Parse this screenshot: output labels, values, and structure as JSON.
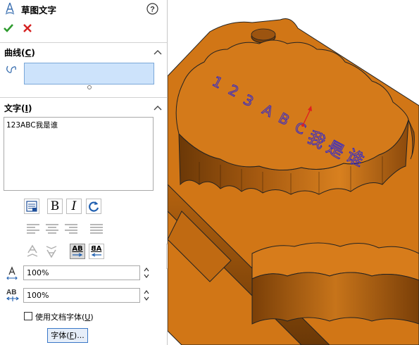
{
  "header": {
    "title": "草图文字",
    "help_icon": "help-icon"
  },
  "actions": {
    "ok_icon": "checkmark-icon",
    "cancel_icon": "close-icon"
  },
  "curves": {
    "label": "曲线(",
    "mnemonic": "C",
    "close": ")",
    "field_value": ""
  },
  "text_section": {
    "label": "文字(",
    "mnemonic": "I",
    "close": ")",
    "content": "123ABC我是谁"
  },
  "format": {
    "bold": "B",
    "italic": "I",
    "align_flip_a": "AB",
    "align_flip_b": "AB"
  },
  "width_factor": {
    "value": "100%"
  },
  "spacing": {
    "value": "100%"
  },
  "doc_font": {
    "label": "使用文档字体(",
    "mnemonic": "U",
    "close": ")",
    "checked": false
  },
  "font_button": {
    "label": "字体(",
    "mnemonic": "F",
    "close": ")..."
  },
  "viewport": {
    "part_color": "#d4781c",
    "sketch_text": "123ABC我是谁",
    "sketch_color": "#2222dd",
    "chars_latin": [
      "1",
      "2",
      "3",
      "A",
      "B",
      "C"
    ],
    "chars_cjk": [
      "我",
      "是",
      "谁"
    ]
  }
}
